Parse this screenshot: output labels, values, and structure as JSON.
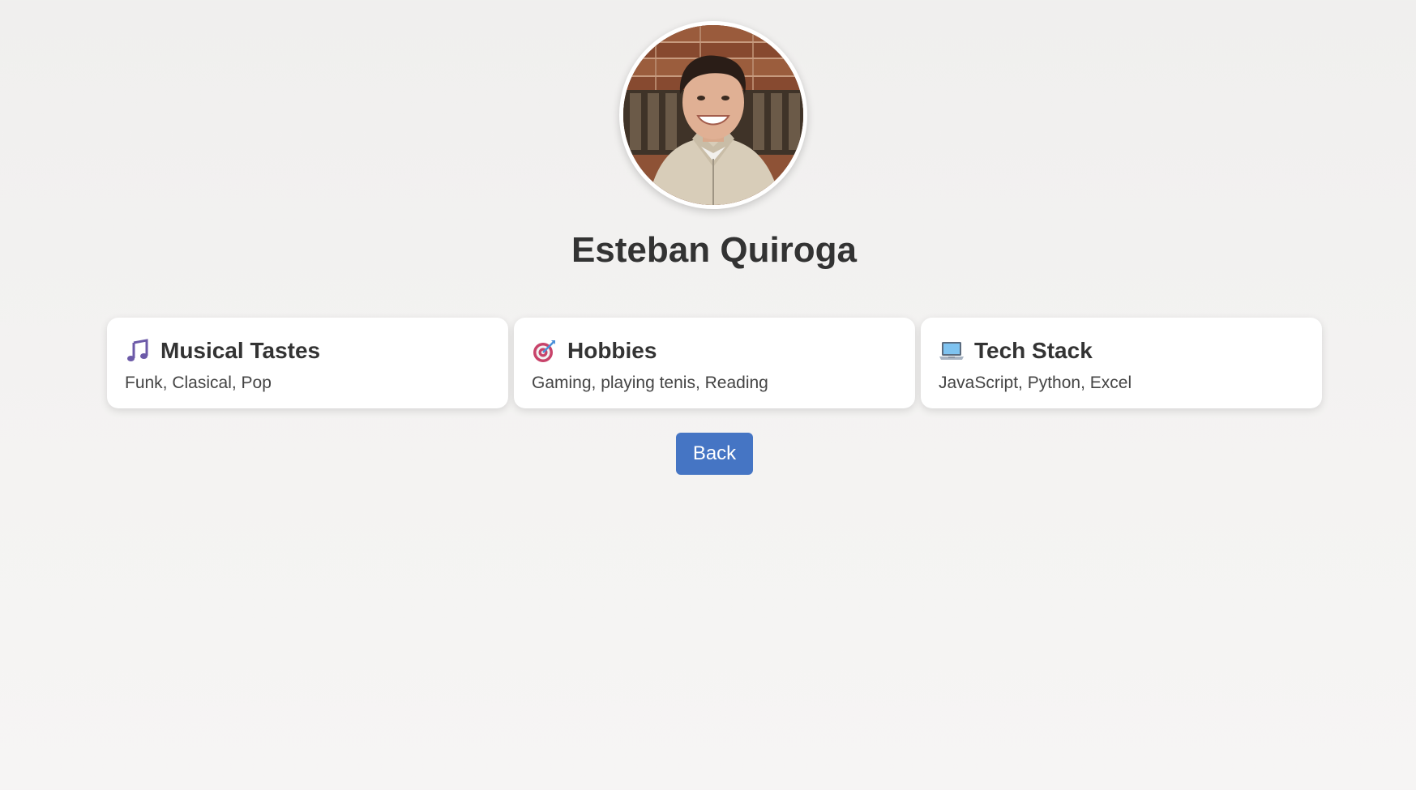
{
  "profile": {
    "name": "Esteban Quiroga",
    "avatar_alt": "profile-photo"
  },
  "cards": [
    {
      "icon": "music-note-icon",
      "title": "Musical Tastes",
      "text": "Funk, Clasical, Pop"
    },
    {
      "icon": "target-icon",
      "title": "Hobbies",
      "text": "Gaming, playing tenis, Reading"
    },
    {
      "icon": "laptop-icon",
      "title": "Tech Stack",
      "text": "JavaScript, Python, Excel"
    }
  ],
  "actions": {
    "back_label": "Back"
  },
  "colors": {
    "accent": "#4575c4",
    "card_background": "#ffffff",
    "text": "#333333"
  }
}
